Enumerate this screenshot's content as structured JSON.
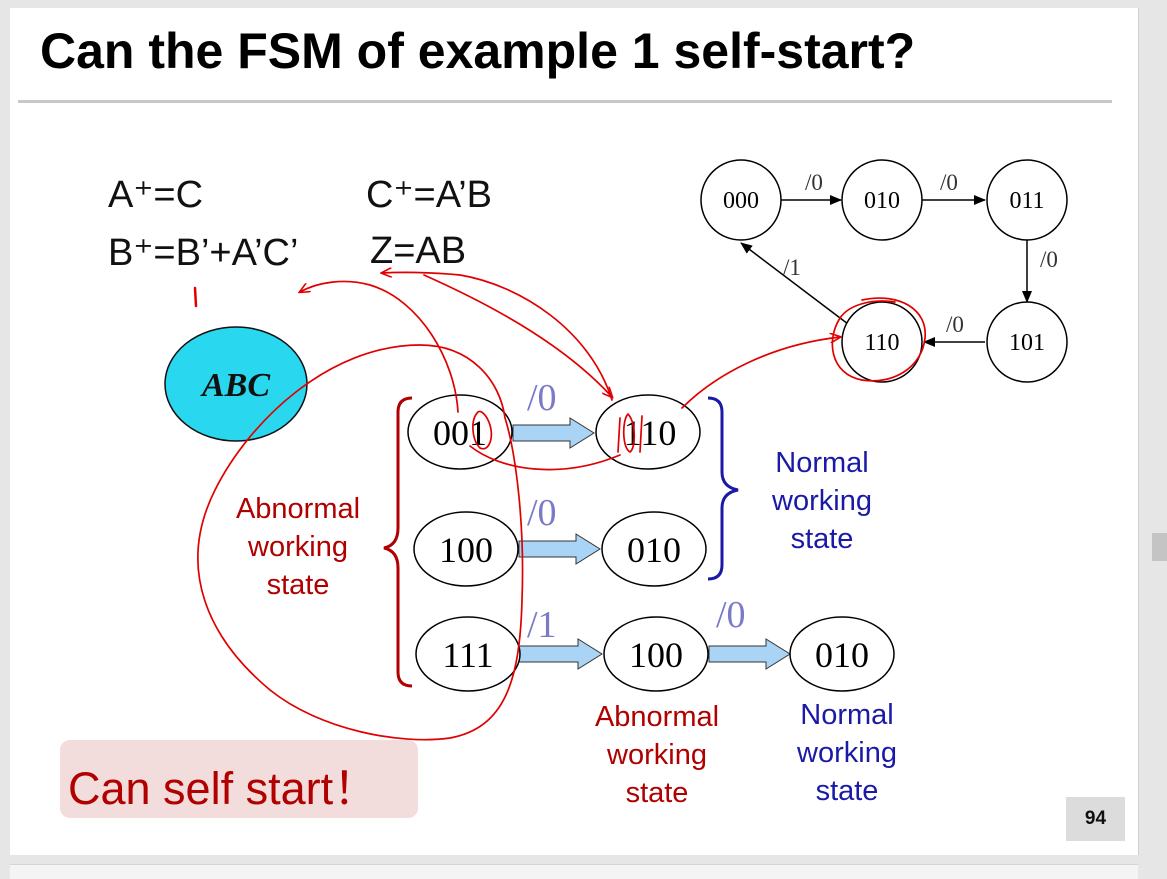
{
  "title": "Can the FSM of example 1 self-start?",
  "equations": {
    "a_next": "A⁺=C",
    "c_next": "C⁺=A’B",
    "b_next": "B⁺=B’+A’C’",
    "z_out": "Z=AB"
  },
  "state_var_label": "ABC",
  "state_graph": {
    "states": [
      "000",
      "010",
      "011",
      "101",
      "110"
    ],
    "transitions": [
      {
        "from": "000",
        "to": "010",
        "label": "/0"
      },
      {
        "from": "010",
        "to": "011",
        "label": "/0"
      },
      {
        "from": "011",
        "to": "101",
        "label": "/0"
      },
      {
        "from": "101",
        "to": "110",
        "label": "/0"
      },
      {
        "from": "110",
        "to": "000",
        "label": "/1"
      }
    ]
  },
  "unused_states": {
    "rows": [
      {
        "from": "001",
        "to": "110",
        "label": "/0"
      },
      {
        "from": "100",
        "to": "010",
        "label": "/0"
      },
      {
        "from": "111",
        "to": "100",
        "label": "/1"
      }
    ],
    "chain": {
      "from": "100",
      "to": "010",
      "label": "/0"
    }
  },
  "group_labels": {
    "abnormal_left": [
      "Abnormal",
      "working",
      "state"
    ],
    "normal_right": [
      "Normal",
      "working",
      "state"
    ],
    "abnormal_bottom": [
      "Abnormal",
      "working",
      "state"
    ],
    "normal_bottom": [
      "Normal",
      "working",
      "state"
    ]
  },
  "conclusion": "Can self start！",
  "page_number": "94",
  "colors": {
    "abnormal_label": "#b00000",
    "normal_label": "#1a1aa6",
    "arrow_fill": "#a9d4f5",
    "arrow_label": "#7a7ac8",
    "ink_red": "#e00000",
    "abc_ellipse": "#29d8ee",
    "callout_bg": "#f3dcdc"
  }
}
